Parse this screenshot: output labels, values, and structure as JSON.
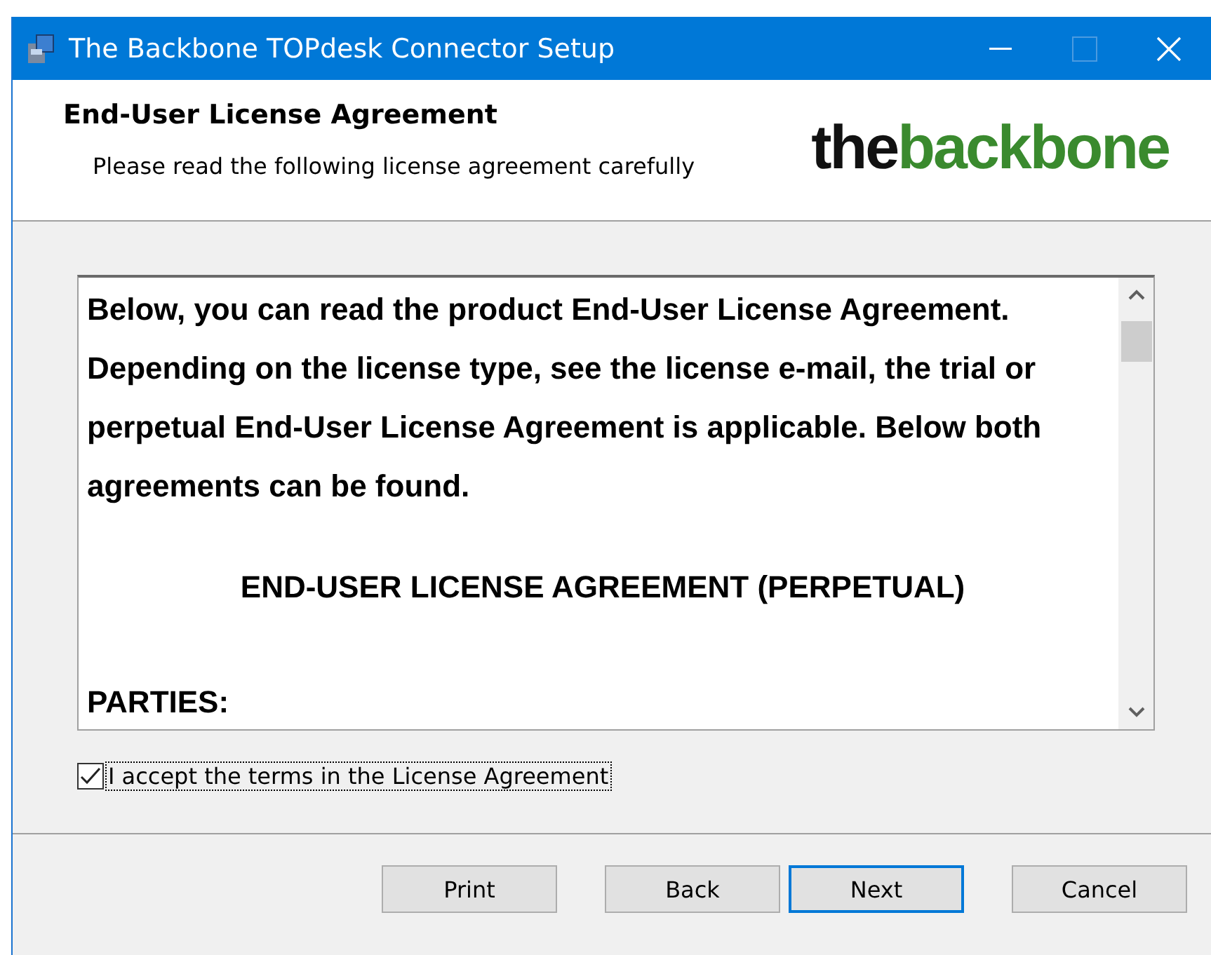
{
  "window": {
    "title": "The Backbone TOPdesk Connector Setup"
  },
  "header": {
    "title": "End-User License Agreement",
    "subtitle": "Please read the following license agreement carefully",
    "logo": [
      {
        "text": "the",
        "color": "#111111"
      },
      {
        "text": "backbone",
        "color": "#3a8a2e"
      }
    ]
  },
  "license_text": [
    {
      "kind": "paragraph",
      "text": "Below, you can read the product End-User License Agreement. Depending on the license type, see the license e-mail, the trial or perpetual End-User License Agreement is applicable. Below both agreements can be found."
    },
    {
      "kind": "heading",
      "text": "END-USER LICENSE AGREEMENT (PERPETUAL)"
    },
    {
      "kind": "paragraph",
      "text": "PARTIES:"
    }
  ],
  "accept": {
    "label": "I accept the terms in the License Agreement",
    "checked": true
  },
  "buttons": [
    {
      "label": "Print",
      "default": false
    },
    {
      "label": "Back",
      "default": false
    },
    {
      "label": "Next",
      "default": true
    },
    {
      "label": "Cancel",
      "default": false
    }
  ]
}
